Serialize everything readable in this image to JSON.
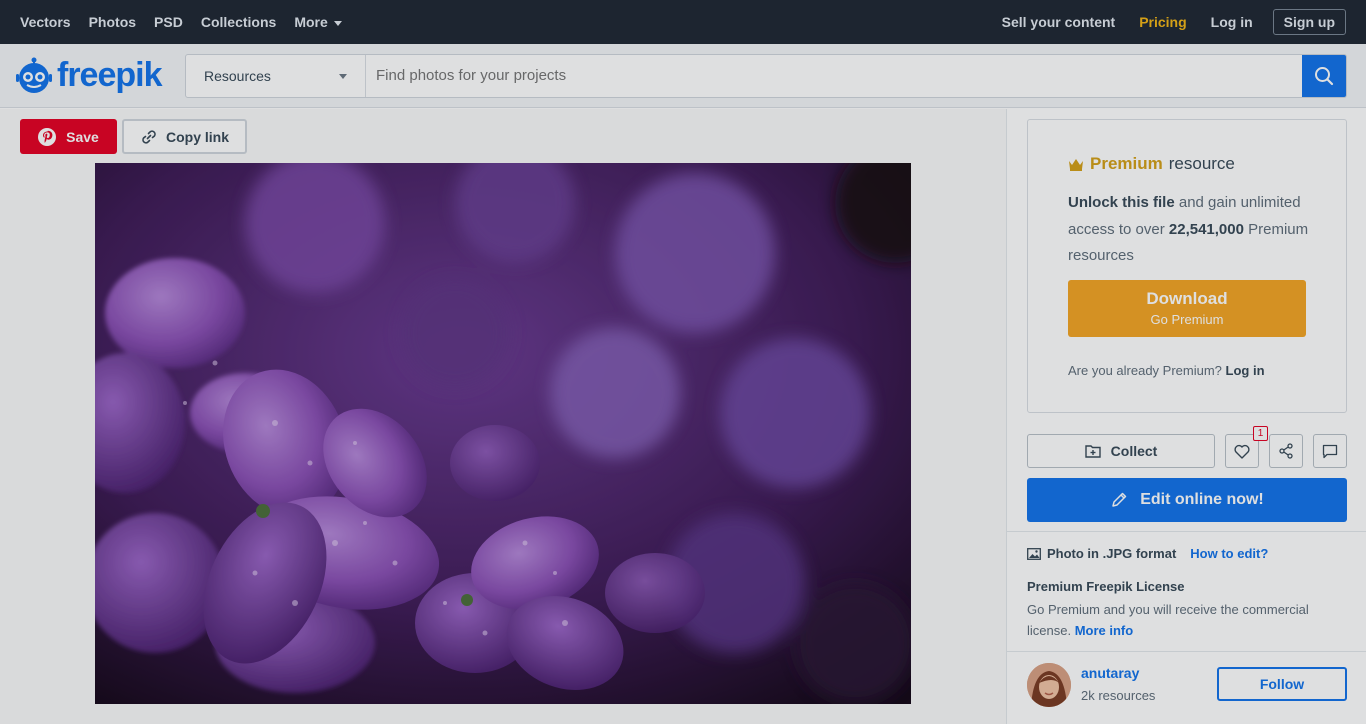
{
  "topnav": {
    "links": [
      "Vectors",
      "Photos",
      "PSD",
      "Collections",
      "More"
    ],
    "sell": "Sell your content",
    "pricing": "Pricing",
    "login": "Log in",
    "signup": "Sign up"
  },
  "header": {
    "brand": "freepik",
    "resource_select": "Resources",
    "search_placeholder": "Find photos for your projects"
  },
  "actions": {
    "save": "Save",
    "copy_link": "Copy link"
  },
  "premium": {
    "title_premium": "Premium",
    "title_rest": "resource",
    "unlock_bold": "Unlock this file",
    "unlock_rest": "and gain unlimited access to over",
    "count": "22,541,000",
    "count_rest": "Premium resources",
    "download": "Download",
    "download_sub": "Go Premium",
    "already": "Are you already Premium?",
    "already_login": "Log in"
  },
  "tools": {
    "collect": "Collect",
    "like_count": "1",
    "edit": "Edit online now!"
  },
  "info": {
    "format": "Photo in .JPG format",
    "how_to_edit": "How to edit?",
    "license_title": "Premium Freepik License",
    "license_text": "Go Premium and you will receive the commercial license.",
    "more_info": "More info"
  },
  "author": {
    "name": "anutaray",
    "resources": "2k resources",
    "follow": "Follow"
  },
  "colors": {
    "brand_blue": "#1273eb",
    "premium_gold": "#d4a017",
    "pinterest_red": "#e60023",
    "nav_bg": "#1d2530"
  }
}
